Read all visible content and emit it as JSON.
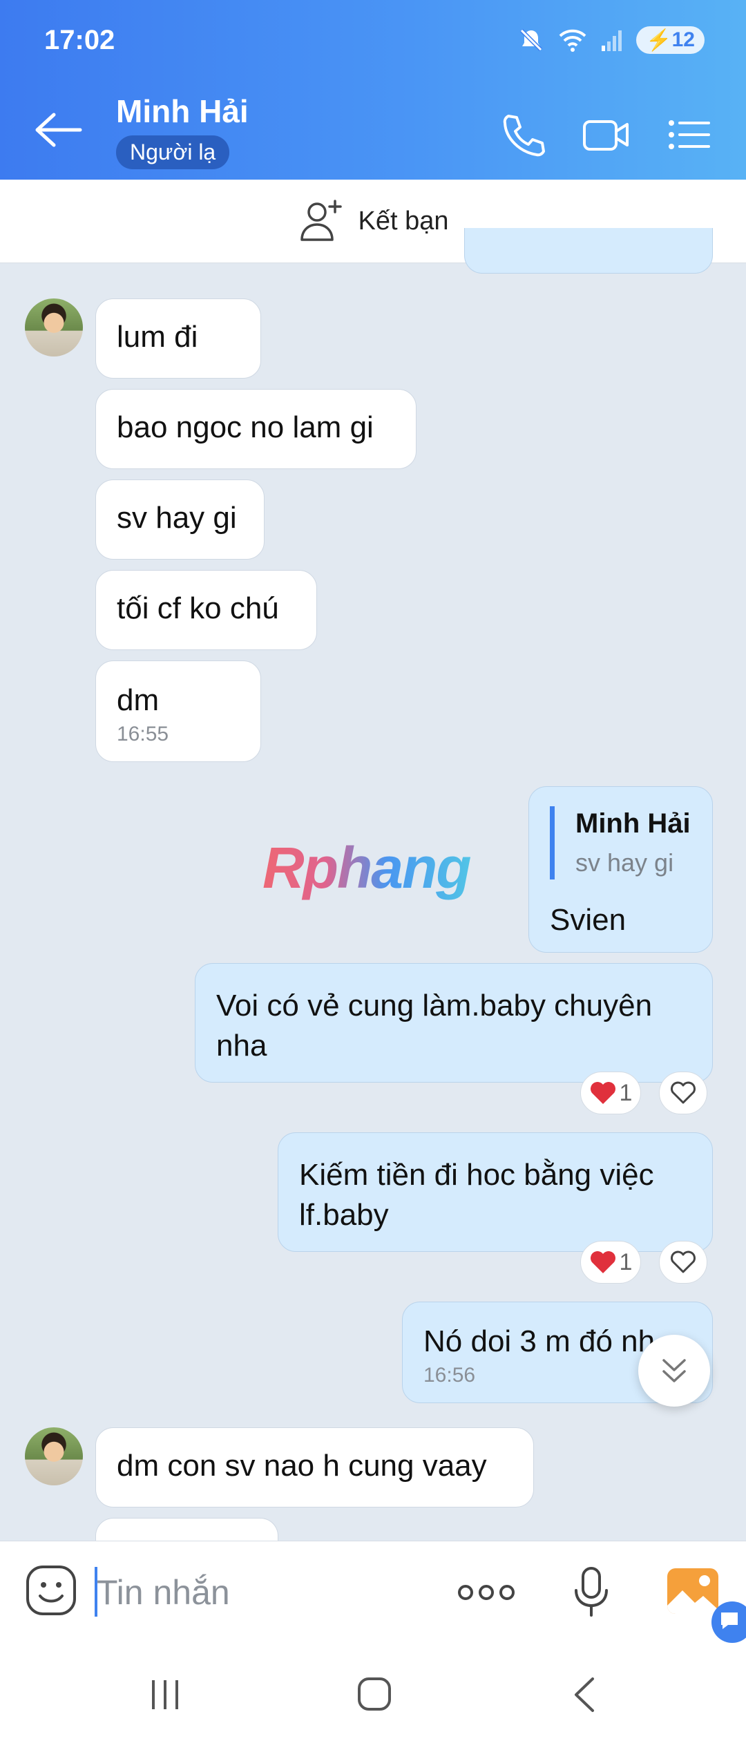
{
  "status": {
    "time": "17:02",
    "battery": "12"
  },
  "header": {
    "name": "Minh Hải",
    "badge": "Người lạ"
  },
  "addbar": {
    "label": "Kết bạn"
  },
  "messages": {
    "m1": "lum đi",
    "m2": "bao ngoc no lam gi",
    "m3": "sv hay gi",
    "m4": "tối cf ko chú",
    "m5": "dm",
    "m5_time": "16:55",
    "reply_name": "Minh Hải",
    "reply_quote": "sv hay gi",
    "reply_text": "Svien",
    "o2": "Voi có vẻ cung làm.baby chuyên nha",
    "o2_reacts": "1",
    "o3": "Kiếm tiền đi hoc bằng việc lf.baby",
    "o3_reacts": "1",
    "o4": "Nó doi 3 m đó nh",
    "o4_time": "16:56",
    "m6": "dm con sv nao h cung vaay"
  },
  "watermark": "Rphang",
  "input": {
    "placeholder": "Tin nhắn"
  },
  "icons": {
    "mute": "mute-icon",
    "wifi": "wifi-icon",
    "signal": "signal-icon",
    "back": "arrow-left-icon",
    "call": "phone-icon",
    "video": "video-icon",
    "menu": "list-menu-icon",
    "add_friend": "add-friend-icon",
    "emoji": "emoji-icon",
    "more": "more-icon",
    "mic": "microphone-icon",
    "gallery": "image-icon",
    "scroll": "chevron-double-down-icon",
    "heart": "heart-icon"
  },
  "colors": {
    "accent": "#3f82ef",
    "outgoing_bubble": "#d5ebfd",
    "chat_bg": "#e2e9f1"
  }
}
